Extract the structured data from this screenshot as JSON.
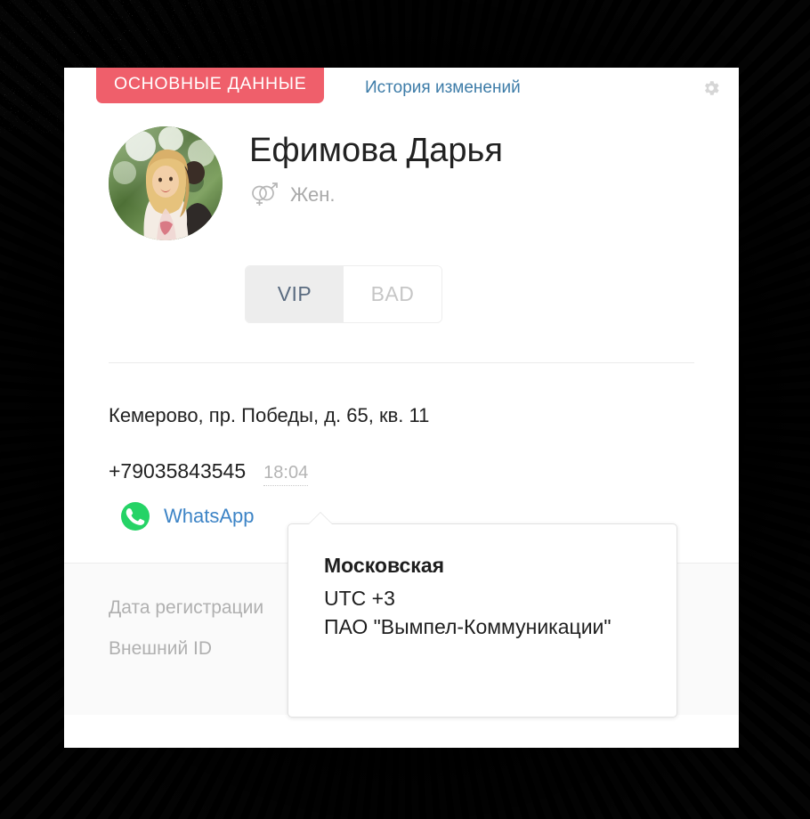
{
  "window": {
    "background_color": "#000000",
    "card_background": "#ffffff"
  },
  "tabs": {
    "active": {
      "label": "ОСНОВНЫЕ ДАННЫЕ",
      "color": "#ef5f6b",
      "text_color": "#ffffff"
    },
    "history": {
      "label": "История изменений",
      "color": "#3d7ca8"
    },
    "settings_icon": "gear-icon"
  },
  "profile": {
    "avatar_alt": "avatar-photo",
    "name": "Ефимова Дарья",
    "gender_icon": "gender-male-female-icon",
    "gender_label": "Жен.",
    "flags": [
      {
        "label": "VIP",
        "active": true
      },
      {
        "label": "BAD",
        "active": false
      }
    ]
  },
  "contact": {
    "address": "Кемерово, пр. Победы, д. 65, кв. 11",
    "phone": "+79035843545",
    "local_time": "18:04",
    "messenger": {
      "icon": "whatsapp-icon",
      "label": "WhatsApp",
      "color": "#25d366",
      "link_color": "#3d84c6"
    }
  },
  "meta": {
    "fields": [
      {
        "label": "Дата регистрации"
      },
      {
        "label": "Внешний ID"
      }
    ]
  },
  "tooltip": {
    "title": "Московская",
    "lines": [
      "UTC +3",
      "ПАО \"Вымпел-Коммуникации\""
    ]
  }
}
